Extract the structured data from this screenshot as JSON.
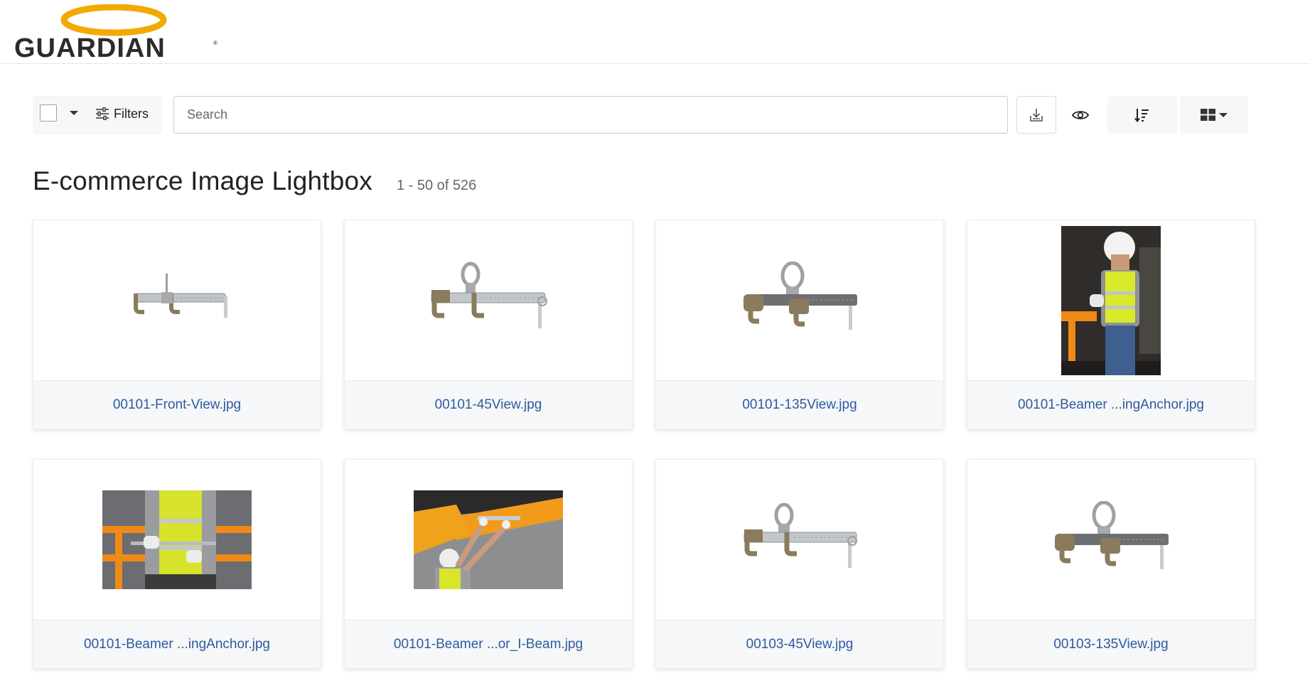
{
  "brand": {
    "name": "GUARDIAN",
    "mark": "®",
    "accent": "#f2a900",
    "text_color": "#2b2b2b"
  },
  "toolbar": {
    "filters_label": "Filters",
    "search_placeholder": "Search",
    "icons": [
      "chevron-down-icon",
      "sliders-icon",
      "download-icon",
      "eye-icon",
      "sort-descending-icon",
      "grid-view-icon"
    ]
  },
  "page": {
    "title": "E-commerce Image Lightbox",
    "count": "1 - 50 of 526",
    "link_color": "#2d5b9e"
  },
  "assets": [
    {
      "file": "00101-Front-View.jpg",
      "kind": "product"
    },
    {
      "file": "00101-45View.jpg",
      "kind": "product"
    },
    {
      "file": "00101-135View.jpg",
      "kind": "product"
    },
    {
      "file": "00101-Beamer ...ingAnchor.jpg",
      "kind": "photo"
    },
    {
      "file": "00101-Beamer ...ingAnchor.jpg",
      "kind": "photo"
    },
    {
      "file": "00101-Beamer ...or_I-Beam.jpg",
      "kind": "photo"
    },
    {
      "file": "00103-45View.jpg",
      "kind": "product"
    },
    {
      "file": "00103-135View.jpg",
      "kind": "product"
    }
  ]
}
